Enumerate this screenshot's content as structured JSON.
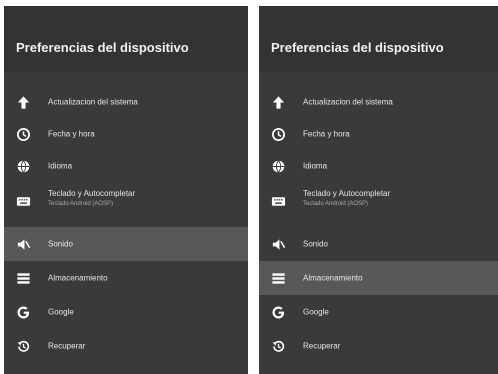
{
  "panels": [
    {
      "title": "Preferencias del dispositivo",
      "selected": "sonido",
      "items": [
        {
          "id": "actualizacion",
          "label": "Actualizacion del sistema",
          "icon": "arrow-up-icon"
        },
        {
          "id": "fecha",
          "label": "Fecha y hora",
          "icon": "clock-icon"
        },
        {
          "id": "idioma",
          "label": "Idioma",
          "icon": "globe-icon"
        },
        {
          "id": "teclado",
          "label": "Teclado y Autocompletar",
          "sublabel": "Teclado Android (AOSP)",
          "icon": "keyboard-icon"
        },
        {
          "id": "sonido",
          "label": "Sonido",
          "icon": "speaker-icon"
        },
        {
          "id": "almacenamiento",
          "label": "Almacenamiento",
          "icon": "storage-icon"
        },
        {
          "id": "google",
          "label": "Google",
          "icon": "google-icon"
        },
        {
          "id": "recuperar",
          "label": "Recuperar",
          "icon": "restore-icon"
        }
      ]
    },
    {
      "title": "Preferencias del dispositivo",
      "selected": "almacenamiento",
      "items": [
        {
          "id": "actualizacion",
          "label": "Actualizacion del sistema",
          "icon": "arrow-up-icon"
        },
        {
          "id": "fecha",
          "label": "Fecha y hora",
          "icon": "clock-icon"
        },
        {
          "id": "idioma",
          "label": "Idioma",
          "icon": "globe-icon"
        },
        {
          "id": "teclado",
          "label": "Teclado y Autocompletar",
          "sublabel": "Teclado Android (AOSP)",
          "icon": "keyboard-icon"
        },
        {
          "id": "sonido",
          "label": "Sonido",
          "icon": "speaker-icon"
        },
        {
          "id": "almacenamiento",
          "label": "Almacenamiento",
          "icon": "storage-icon"
        },
        {
          "id": "google",
          "label": "Google",
          "icon": "google-icon"
        },
        {
          "id": "recuperar",
          "label": "Recuperar",
          "icon": "restore-icon"
        }
      ]
    }
  ],
  "colors": {
    "panel_bg": "#3a3a3a",
    "header_bg": "#333333",
    "selected_bg": "#585858",
    "text": "#e6e6e6",
    "subtext": "#a8a8a8",
    "icon": "#ffffff"
  }
}
